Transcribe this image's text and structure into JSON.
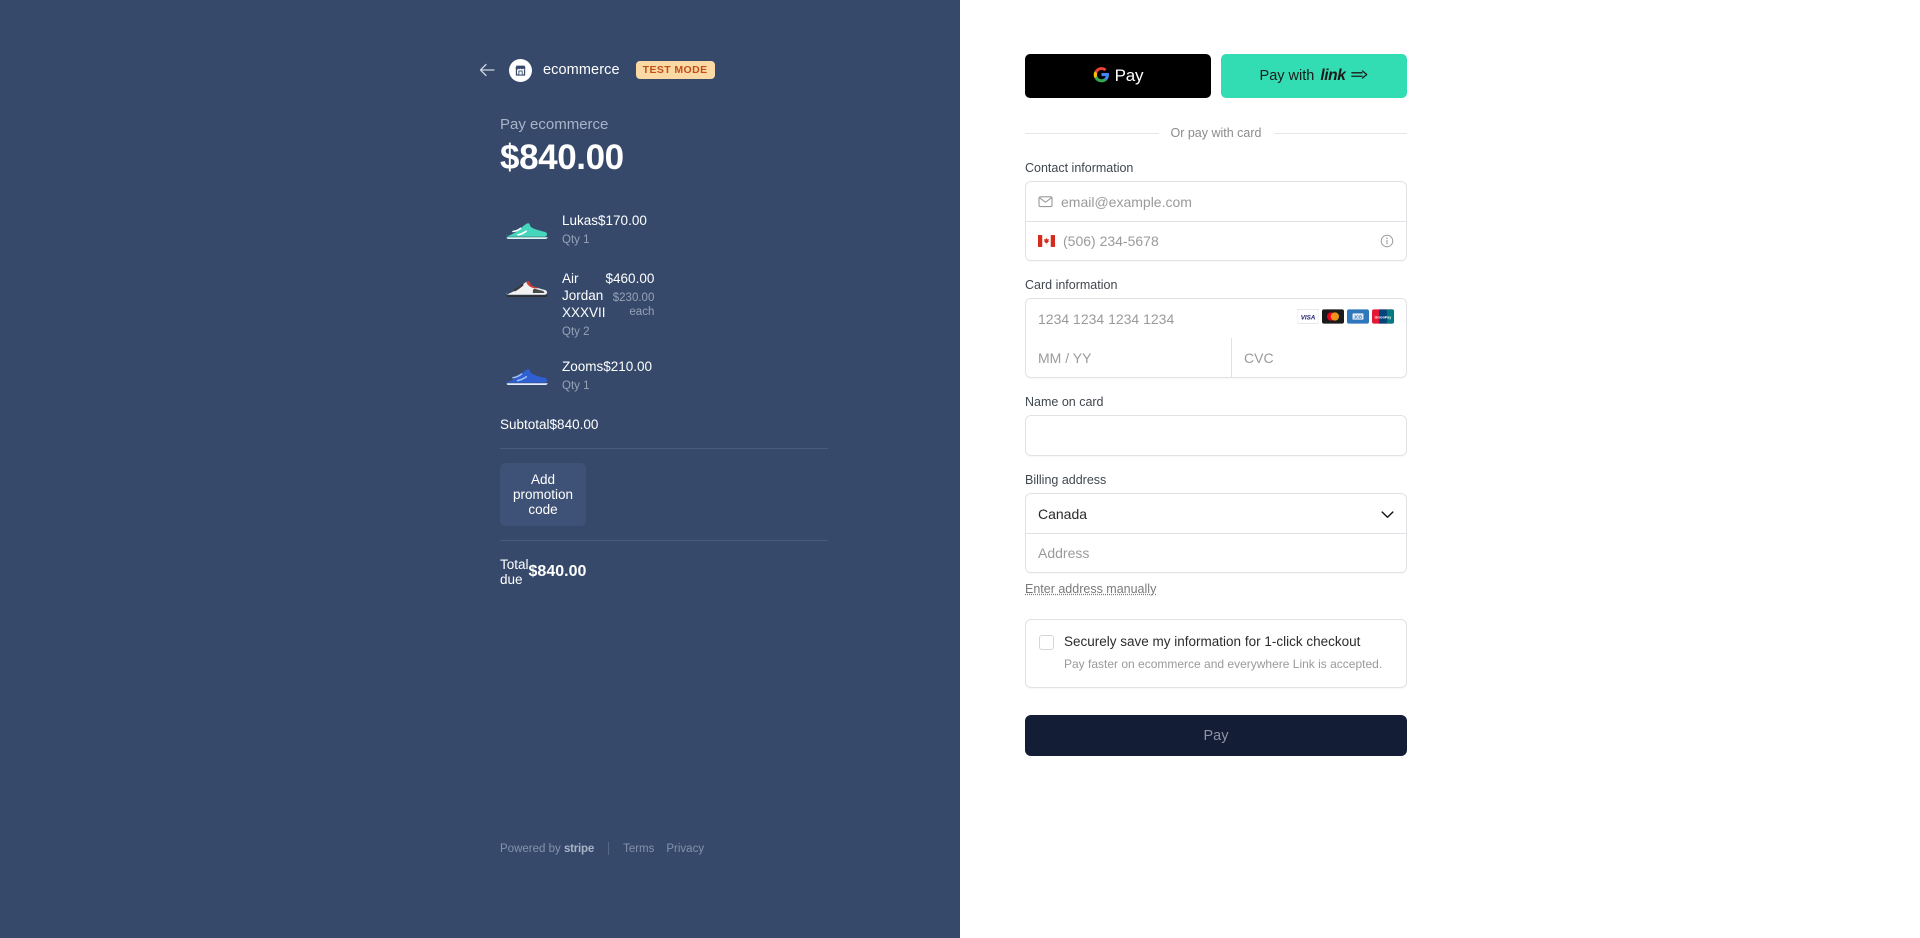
{
  "merchant": {
    "back_icon": "back-arrow-icon",
    "logo_icon": "store-icon",
    "name": "ecommerce",
    "test_badge": "TEST MODE"
  },
  "summary": {
    "pay_label": "Pay ecommerce",
    "amount": "$840.00",
    "items": [
      {
        "name": "Lukas",
        "qty": "Qty 1",
        "price": "$170.00",
        "each": "",
        "thumb": "sneaker-teal-icon"
      },
      {
        "name": "Air Jordan XXXVII",
        "qty": "Qty 2",
        "price": "$460.00",
        "each": "$230.00 each",
        "thumb": "sneaker-white-red-icon"
      },
      {
        "name": "Zooms",
        "qty": "Qty 1",
        "price": "$210.00",
        "each": "",
        "thumb": "sneaker-blue-icon"
      }
    ],
    "subtotal_label": "Subtotal",
    "subtotal_value": "$840.00",
    "promo_label": "Add promotion code",
    "total_label": "Total due",
    "total_value": "$840.00"
  },
  "footer": {
    "powered_prefix": "Powered by ",
    "powered_brand": "stripe",
    "terms": "Terms",
    "privacy": "Privacy"
  },
  "wallets": {
    "gpay_label": "Pay",
    "gpay_icon": "google-g-icon",
    "link_prefix": "Pay with ",
    "link_word": "link",
    "link_arrow": "⇛",
    "divider_text": "Or pay with card"
  },
  "contact": {
    "label": "Contact information",
    "email_placeholder": "email@example.com",
    "email_value": "",
    "email_icon": "envelope-icon",
    "phone_placeholder": "(506) 234-5678",
    "phone_value": "",
    "phone_flag": "canada-flag-icon",
    "phone_info_icon": "info-circle-icon"
  },
  "card": {
    "label": "Card information",
    "number_placeholder": "1234 1234 1234 1234",
    "number_value": "",
    "expiry_placeholder": "MM / YY",
    "expiry_value": "",
    "cvc_placeholder": "CVC",
    "cvc_value": "",
    "brands": [
      "visa-icon",
      "mastercard-icon",
      "amex-icon",
      "unionpay-icon"
    ],
    "cvc_hint_icon": "card-back-cvc-icon"
  },
  "name_on_card": {
    "label": "Name on card",
    "value": "",
    "placeholder": ""
  },
  "billing": {
    "label": "Billing address",
    "country_value": "Canada",
    "country_chevron_icon": "chevron-down-icon",
    "address_placeholder": "Address",
    "address_value": "",
    "manual_link": "Enter address manually"
  },
  "save_info": {
    "checked": false,
    "title": "Securely save my information for 1-click checkout",
    "subtitle": "Pay faster on ecommerce and everywhere Link is accepted."
  },
  "submit": {
    "label": "Pay"
  },
  "colors": {
    "left_bg": "#36496b",
    "link_green": "#33ddb3",
    "pay_button": "#131d35",
    "test_badge_bg": "#fbd9a5",
    "test_badge_text": "#c0501a"
  }
}
